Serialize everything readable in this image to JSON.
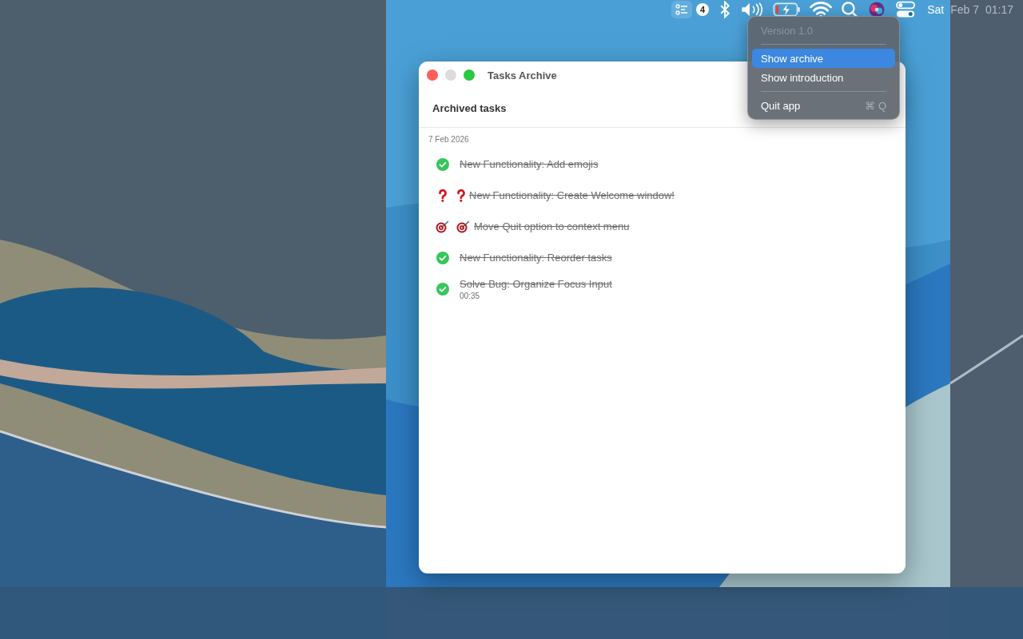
{
  "menubar": {
    "badge": "4",
    "clock": [
      {
        "text": "Sat",
        "dimmed": false
      },
      {
        "text": "Feb 7",
        "dimmed": true
      },
      {
        "text": "01:17",
        "dimmed": true
      }
    ]
  },
  "menu": {
    "items": [
      {
        "kind": "item",
        "label": "Version 1.0",
        "disabled": true,
        "selected": false
      },
      {
        "kind": "separator"
      },
      {
        "kind": "item",
        "label": "Show archive",
        "disabled": false,
        "selected": true
      },
      {
        "kind": "item",
        "label": "Show introduction",
        "disabled": false,
        "selected": false
      },
      {
        "kind": "separator"
      },
      {
        "kind": "item",
        "label": "Quit app",
        "shortcut": "⌘ Q",
        "disabled": false,
        "selected": false
      }
    ]
  },
  "window": {
    "title": "Tasks Archive",
    "header": "Archived tasks",
    "groups": [
      {
        "date": "7 Feb 2026",
        "tasks": [
          {
            "kind": "check",
            "emoji_prefix": false,
            "done": true,
            "title": "New Functionality: Add emojis"
          },
          {
            "kind": "question",
            "emoji_prefix": true,
            "done": true,
            "title": "New Functionality: Create Welcome window!"
          },
          {
            "kind": "target",
            "emoji_prefix": true,
            "done": true,
            "title": "Move Quit option to context menu"
          },
          {
            "kind": "check",
            "emoji_prefix": false,
            "done": true,
            "title": "New Functionality: Reorder tasks"
          },
          {
            "kind": "check",
            "emoji_prefix": false,
            "done": true,
            "title": "Solve Bug: Organize Focus Input",
            "duration": "00:35"
          }
        ]
      }
    ]
  }
}
